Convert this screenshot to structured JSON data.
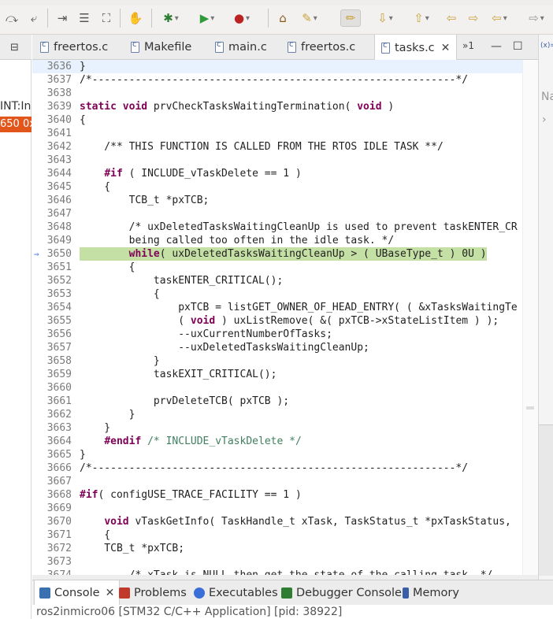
{
  "toolbar": {
    "icons": [
      "step-return-icon",
      "drop-to-frame-icon",
      "instruction-stepping-icon",
      "reset-icon",
      "use-step-filters-icon",
      "debug-icon",
      "run-icon",
      "external-tools-icon",
      "open-type-icon",
      "search-icon",
      "annotation-icon",
      "next-annotation-icon",
      "previous-annotation-icon",
      "back-icon",
      "forward-icon"
    ]
  },
  "left_panel": {
    "label": "INT:In",
    "value": "650 0x"
  },
  "editor_tabs": [
    {
      "label": "freertos.c",
      "icon": "c-file-icon",
      "active": false
    },
    {
      "label": "Makefile",
      "icon": "makefile-icon",
      "active": false
    },
    {
      "label": "main.c",
      "icon": "c-file-icon",
      "active": false
    },
    {
      "label": "freertos.c",
      "icon": "c-file-icon",
      "active": false
    },
    {
      "label": "tasks.c",
      "icon": "c-file-icon",
      "active": true
    }
  ],
  "editor_overflow": "»1",
  "right_panel": {
    "expr": "(x)=",
    "name_label": "Na"
  },
  "code": {
    "current_line": 3650,
    "lines": [
      {
        "n": "3636",
        "t": "}"
      },
      {
        "n": "3637",
        "t": "/*-----------------------------------------------------------*/"
      },
      {
        "n": "3638",
        "t": ""
      },
      {
        "n": "3639",
        "t": "static void prvCheckTasksWaitingTermination( void )"
      },
      {
        "n": "3640",
        "t": "{"
      },
      {
        "n": "3641",
        "t": ""
      },
      {
        "n": "3642",
        "t": "    /** THIS FUNCTION IS CALLED FROM THE RTOS IDLE TASK **/"
      },
      {
        "n": "3643",
        "t": ""
      },
      {
        "n": "3644",
        "t": "    #if ( INCLUDE_vTaskDelete == 1 )"
      },
      {
        "n": "3645",
        "t": "    {"
      },
      {
        "n": "3646",
        "t": "        TCB_t *pxTCB;"
      },
      {
        "n": "3647",
        "t": ""
      },
      {
        "n": "3648",
        "t": "        /* uxDeletedTasksWaitingCleanUp is used to prevent taskENTER_CR"
      },
      {
        "n": "3649",
        "t": "        being called too often in the idle task. */"
      },
      {
        "n": "3650",
        "t": "        while( uxDeletedTasksWaitingCleanUp > ( UBaseType_t ) 0U )"
      },
      {
        "n": "3651",
        "t": "        {"
      },
      {
        "n": "3652",
        "t": "            taskENTER_CRITICAL();"
      },
      {
        "n": "3653",
        "t": "            {"
      },
      {
        "n": "3654",
        "t": "                pxTCB = listGET_OWNER_OF_HEAD_ENTRY( ( &xTasksWaitingTe"
      },
      {
        "n": "3655",
        "t": "                ( void ) uxListRemove( &( pxTCB->xStateListItem ) );"
      },
      {
        "n": "3656",
        "t": "                --uxCurrentNumberOfTasks;"
      },
      {
        "n": "3657",
        "t": "                --uxDeletedTasksWaitingCleanUp;"
      },
      {
        "n": "3658",
        "t": "            }"
      },
      {
        "n": "3659",
        "t": "            taskEXIT_CRITICAL();"
      },
      {
        "n": "3660",
        "t": ""
      },
      {
        "n": "3661",
        "t": "            prvDeleteTCB( pxTCB );"
      },
      {
        "n": "3662",
        "t": "        }"
      },
      {
        "n": "3663",
        "t": "    }"
      },
      {
        "n": "3664",
        "t": "    #endif /* INCLUDE_vTaskDelete */"
      },
      {
        "n": "3665",
        "t": "}"
      },
      {
        "n": "3666",
        "t": "/*-----------------------------------------------------------*/"
      },
      {
        "n": "3667",
        "t": ""
      },
      {
        "n": "3668",
        "t": "#if( configUSE_TRACE_FACILITY == 1 )"
      },
      {
        "n": "3669",
        "t": ""
      },
      {
        "n": "3670",
        "t": "    void vTaskGetInfo( TaskHandle_t xTask, TaskStatus_t *pxTaskStatus,"
      },
      {
        "n": "3671",
        "t": "    {"
      },
      {
        "n": "3672",
        "t": "    TCB_t *pxTCB;"
      },
      {
        "n": "3673",
        "t": ""
      },
      {
        "n": "3674",
        "t": "        /* xTask is NULL then get the state of the calling task. */"
      }
    ]
  },
  "bottom_tabs": [
    {
      "label": "Console",
      "icon": "console-icon",
      "color": "#3a6fb0",
      "active": true
    },
    {
      "label": "Problems",
      "icon": "problems-icon",
      "color": "#c0392b",
      "active": false
    },
    {
      "label": "Executables",
      "icon": "executables-icon",
      "color": "#3a6fd8",
      "active": false
    },
    {
      "label": "Debugger Console",
      "icon": "debugger-console-icon",
      "color": "#2e7d32",
      "active": false
    },
    {
      "label": "Memory",
      "icon": "memory-icon",
      "color": "#3a5ea8",
      "active": false
    }
  ],
  "status": "ros2inmicro06 [STM32 C/C++ Application] [pid: 38922]",
  "colors": {
    "keyword": "#7f0055",
    "comment": "#3f7f5f",
    "execution_highlight": "#c5e0a5",
    "current_line": "#e8f2fe",
    "error_badge": "#e2561c"
  }
}
